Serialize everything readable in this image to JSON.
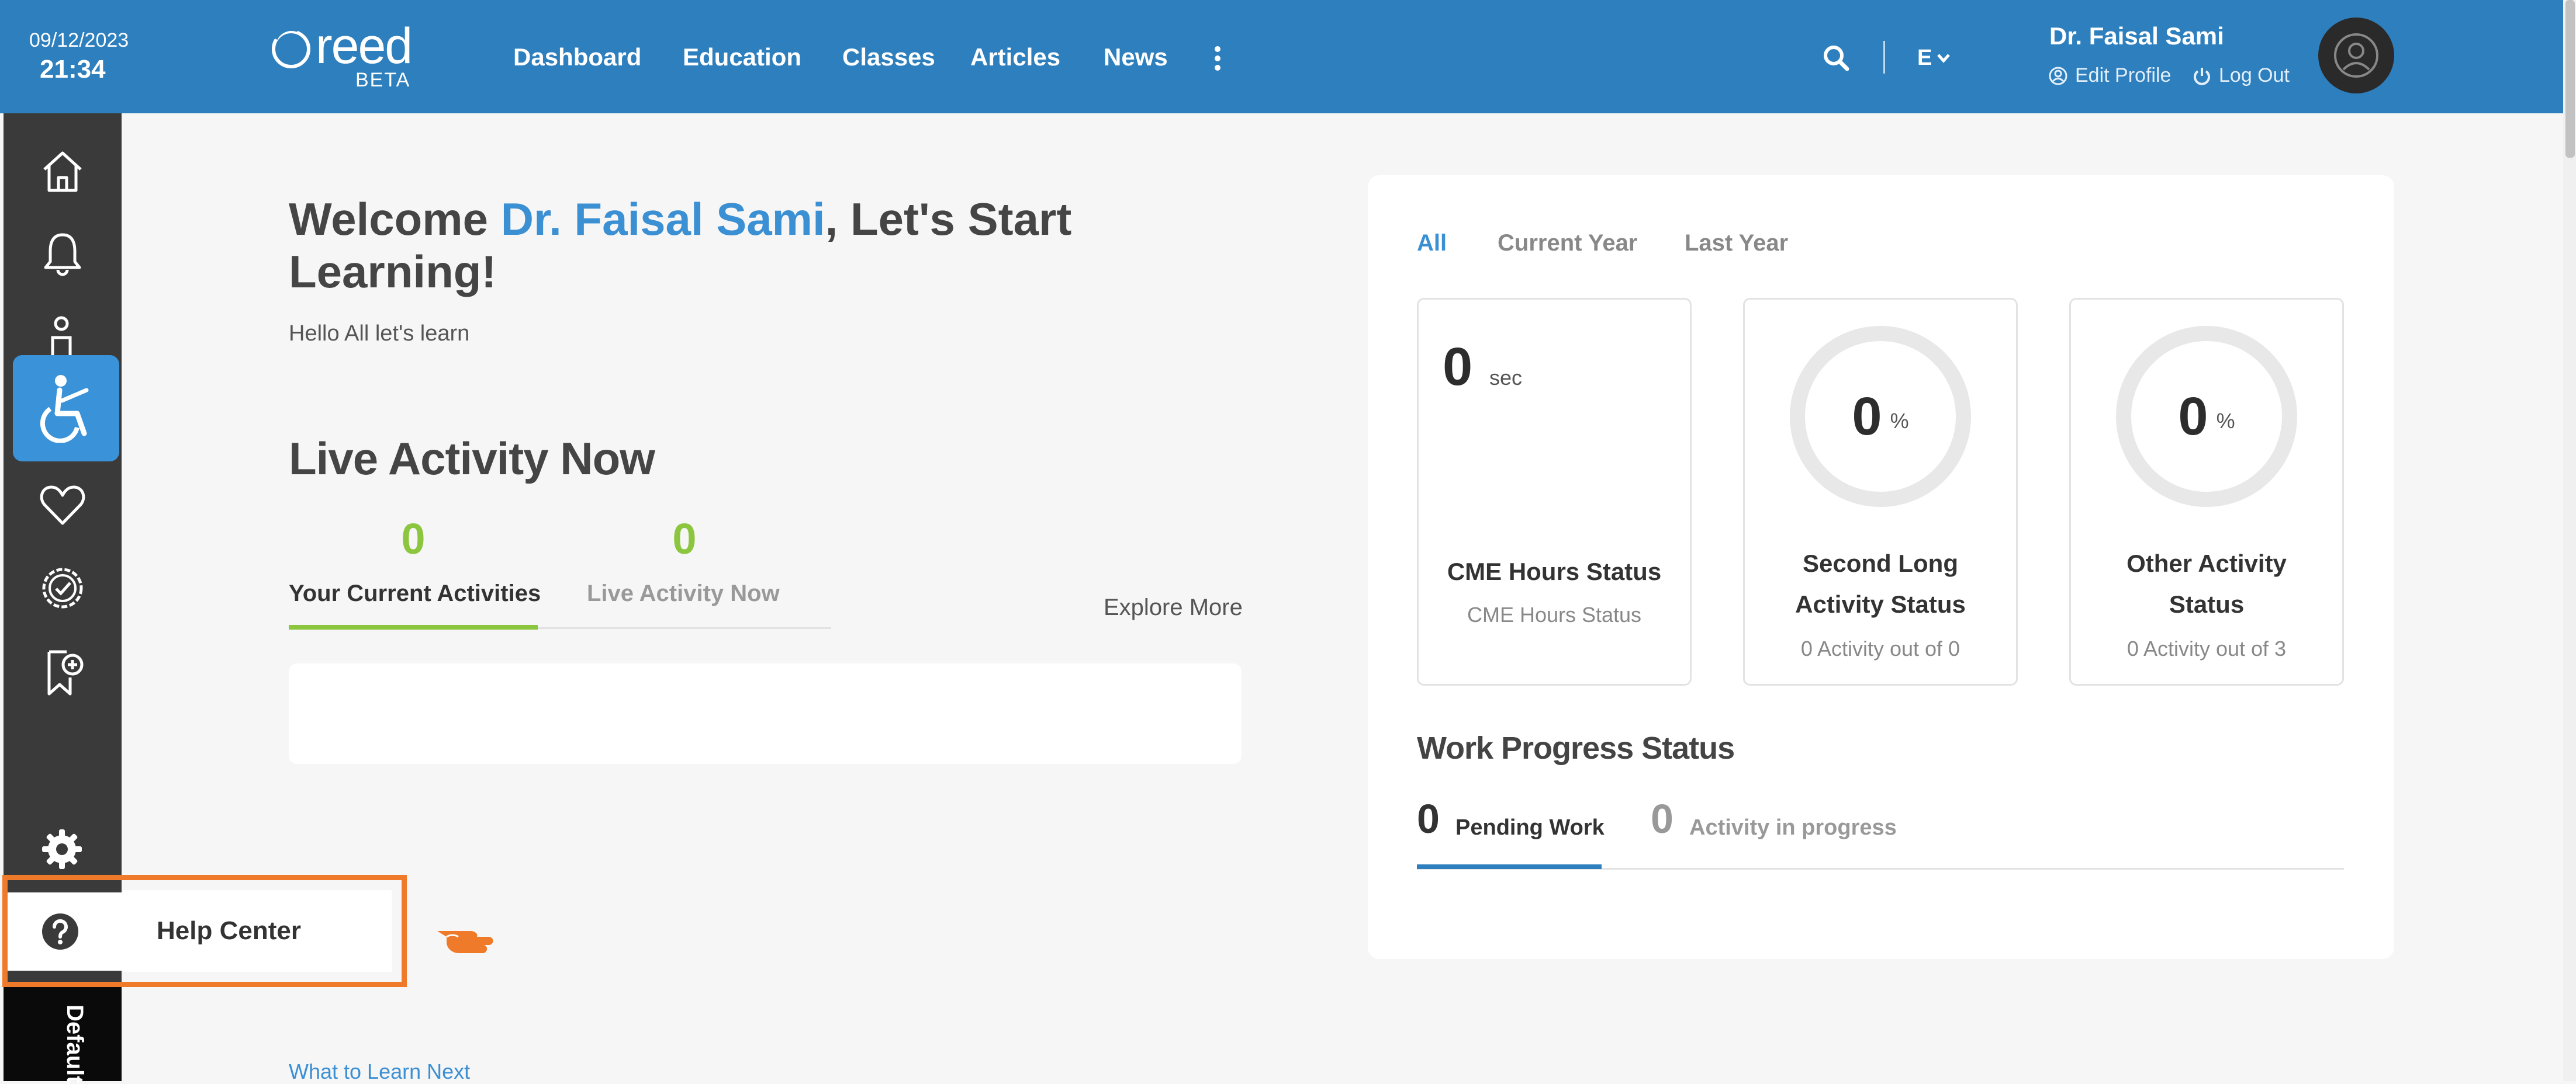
{
  "header": {
    "date": "09/12/2023",
    "time": "21:34",
    "logo_text": "reed",
    "beta": "BETA",
    "nav": [
      "Dashboard",
      "Education",
      "Classes",
      "Articles",
      "News"
    ],
    "lang": "E",
    "user_name": "Dr. Faisal Sami",
    "edit_profile": "Edit Profile",
    "logout": "Log Out",
    "color": "#2e7fbd"
  },
  "sidebar": {
    "items": [
      "home-icon",
      "bell-icon",
      "person-teaching-icon",
      "accessibility-icon",
      "heart-icon",
      "badge-check-icon",
      "bookmark-plus-icon",
      "gear-icon",
      "question-circle-icon"
    ],
    "bottom_label": "Default",
    "active_color": "#3a92d8"
  },
  "help": {
    "label": "Help Center",
    "highlight_color": "#ef7a2a"
  },
  "welcome": {
    "prefix": "Welcome ",
    "name": "Dr. Faisal Sami",
    "suffix": ", Let's Start Learning!",
    "subtitle": "Hello All let's learn"
  },
  "live": {
    "title": "Live Activity Now",
    "tabs": [
      {
        "count": "0",
        "label": "Your Current Activities"
      },
      {
        "count": "0",
        "label": "Live Activity Now"
      }
    ],
    "explore": "Explore More",
    "next_link": "What to Learn Next"
  },
  "panel": {
    "filters": [
      "All",
      "Current Year",
      "Last Year"
    ],
    "cards": [
      {
        "value": "0",
        "unit": "sec",
        "title": "CME Hours Status",
        "subtitle": "CME Hours Status"
      },
      {
        "value": "0",
        "unit": "%",
        "title_line1": "Second Long",
        "title_line2": "Activity Status",
        "subtitle": "0 Activity out of 0"
      },
      {
        "value": "0",
        "unit": "%",
        "title_line1": "Other Activity",
        "title_line2": "Status",
        "subtitle": "0 Activity out of 3"
      }
    ],
    "work_title": "Work Progress Status",
    "work_tabs": [
      {
        "count": "0",
        "label": "Pending Work"
      },
      {
        "count": "0",
        "label": "Activity in progress"
      }
    ]
  }
}
